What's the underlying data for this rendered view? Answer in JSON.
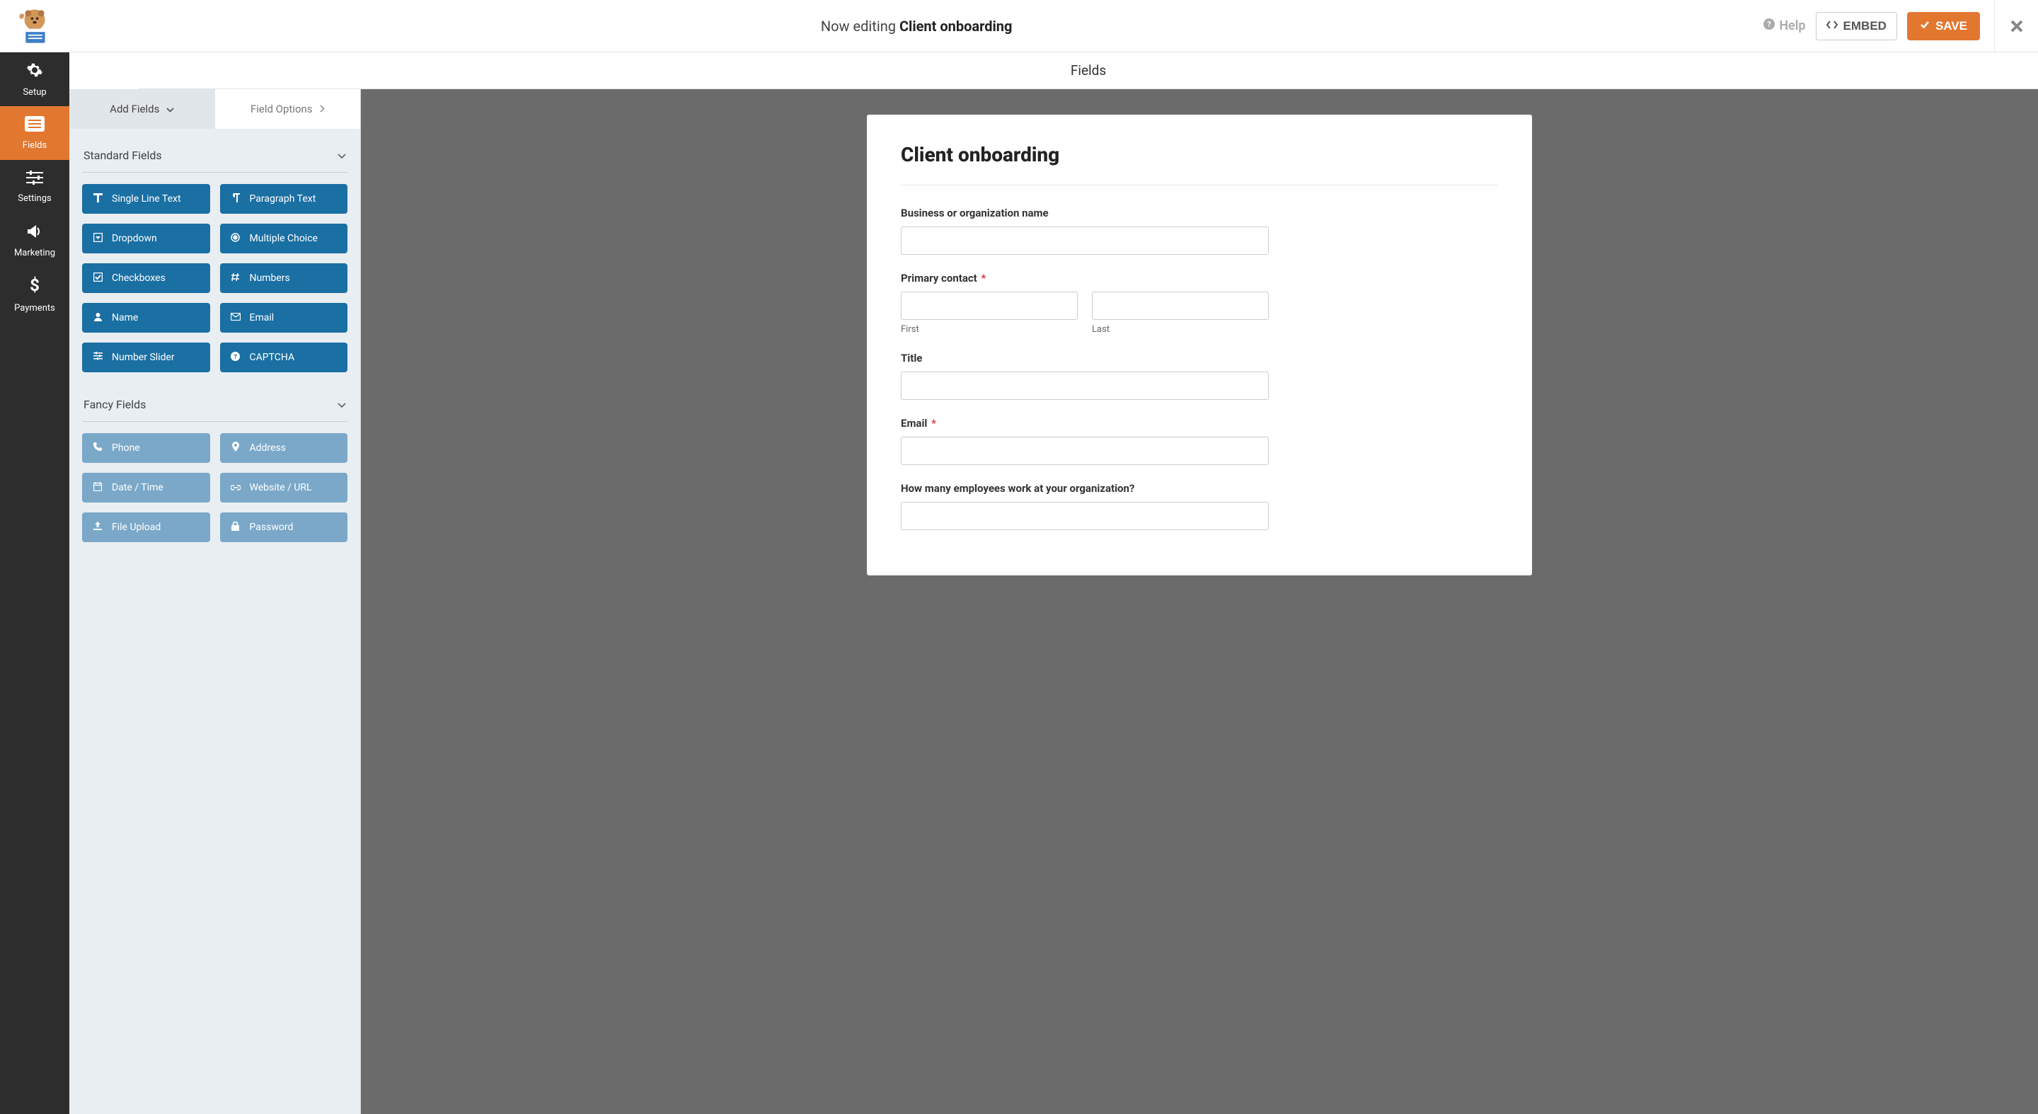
{
  "header": {
    "editing_prefix": "Now editing",
    "form_name": "Client onboarding",
    "help": "Help",
    "embed": "EMBED",
    "save": "SAVE"
  },
  "section_title": "Fields",
  "sidebar": [
    {
      "label": "Setup",
      "icon": "gear"
    },
    {
      "label": "Fields",
      "icon": "form",
      "active": true
    },
    {
      "label": "Settings",
      "icon": "sliders"
    },
    {
      "label": "Marketing",
      "icon": "bullhorn"
    },
    {
      "label": "Payments",
      "icon": "dollar"
    }
  ],
  "panel_tabs": {
    "add": "Add Fields",
    "options": "Field Options"
  },
  "groups": [
    {
      "title": "Standard Fields",
      "style": "standard",
      "fields": [
        {
          "label": "Single Line Text",
          "icon": "text"
        },
        {
          "label": "Paragraph Text",
          "icon": "paragraph"
        },
        {
          "label": "Dropdown",
          "icon": "dropdown"
        },
        {
          "label": "Multiple Choice",
          "icon": "radio"
        },
        {
          "label": "Checkboxes",
          "icon": "check"
        },
        {
          "label": "Numbers",
          "icon": "hash"
        },
        {
          "label": "Name",
          "icon": "user"
        },
        {
          "label": "Email",
          "icon": "envelope"
        },
        {
          "label": "Number Slider",
          "icon": "sliders-h"
        },
        {
          "label": "CAPTCHA",
          "icon": "question"
        }
      ]
    },
    {
      "title": "Fancy Fields",
      "style": "fancy",
      "fields": [
        {
          "label": "Phone",
          "icon": "phone"
        },
        {
          "label": "Address",
          "icon": "pin"
        },
        {
          "label": "Date / Time",
          "icon": "calendar"
        },
        {
          "label": "Website / URL",
          "icon": "link"
        },
        {
          "label": "File Upload",
          "icon": "upload"
        },
        {
          "label": "Password",
          "icon": "lock"
        }
      ]
    }
  ],
  "form": {
    "title": "Client onboarding",
    "fields": [
      {
        "type": "text",
        "label": "Business or organization name"
      },
      {
        "type": "name",
        "label": "Primary contact",
        "required": true,
        "sub_first": "First",
        "sub_last": "Last"
      },
      {
        "type": "text",
        "label": "Title"
      },
      {
        "type": "text",
        "label": "Email",
        "required": true
      },
      {
        "type": "text",
        "label": "How many employees work at your organization?"
      }
    ]
  },
  "icons": {
    "gear": "⚙",
    "form": "▤",
    "sliders": "⚙",
    "bullhorn": "📣",
    "dollar": "$",
    "text": "T",
    "paragraph": "¶",
    "dropdown": "▾",
    "radio": "◉",
    "check": "☑",
    "hash": "#",
    "user": "👤",
    "envelope": "✉",
    "sliders-h": "☰",
    "question": "?",
    "phone": "✆",
    "pin": "📍",
    "calendar": "🗓",
    "link": "🔗",
    "upload": "⤴",
    "lock": "🔒"
  }
}
